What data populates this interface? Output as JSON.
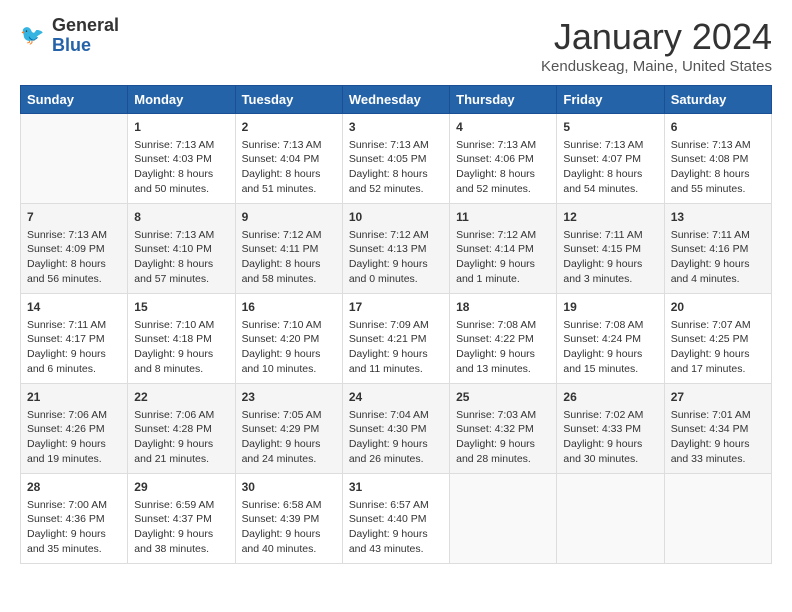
{
  "logo": {
    "line1": "General",
    "line2": "Blue"
  },
  "title": "January 2024",
  "location": "Kenduskeag, Maine, United States",
  "days_of_week": [
    "Sunday",
    "Monday",
    "Tuesday",
    "Wednesday",
    "Thursday",
    "Friday",
    "Saturday"
  ],
  "weeks": [
    [
      {
        "day": "",
        "content": ""
      },
      {
        "day": "1",
        "content": "Sunrise: 7:13 AM\nSunset: 4:03 PM\nDaylight: 8 hours\nand 50 minutes."
      },
      {
        "day": "2",
        "content": "Sunrise: 7:13 AM\nSunset: 4:04 PM\nDaylight: 8 hours\nand 51 minutes."
      },
      {
        "day": "3",
        "content": "Sunrise: 7:13 AM\nSunset: 4:05 PM\nDaylight: 8 hours\nand 52 minutes."
      },
      {
        "day": "4",
        "content": "Sunrise: 7:13 AM\nSunset: 4:06 PM\nDaylight: 8 hours\nand 52 minutes."
      },
      {
        "day": "5",
        "content": "Sunrise: 7:13 AM\nSunset: 4:07 PM\nDaylight: 8 hours\nand 54 minutes."
      },
      {
        "day": "6",
        "content": "Sunrise: 7:13 AM\nSunset: 4:08 PM\nDaylight: 8 hours\nand 55 minutes."
      }
    ],
    [
      {
        "day": "7",
        "content": "Sunrise: 7:13 AM\nSunset: 4:09 PM\nDaylight: 8 hours\nand 56 minutes."
      },
      {
        "day": "8",
        "content": "Sunrise: 7:13 AM\nSunset: 4:10 PM\nDaylight: 8 hours\nand 57 minutes."
      },
      {
        "day": "9",
        "content": "Sunrise: 7:12 AM\nSunset: 4:11 PM\nDaylight: 8 hours\nand 58 minutes."
      },
      {
        "day": "10",
        "content": "Sunrise: 7:12 AM\nSunset: 4:13 PM\nDaylight: 9 hours\nand 0 minutes."
      },
      {
        "day": "11",
        "content": "Sunrise: 7:12 AM\nSunset: 4:14 PM\nDaylight: 9 hours\nand 1 minute."
      },
      {
        "day": "12",
        "content": "Sunrise: 7:11 AM\nSunset: 4:15 PM\nDaylight: 9 hours\nand 3 minutes."
      },
      {
        "day": "13",
        "content": "Sunrise: 7:11 AM\nSunset: 4:16 PM\nDaylight: 9 hours\nand 4 minutes."
      }
    ],
    [
      {
        "day": "14",
        "content": "Sunrise: 7:11 AM\nSunset: 4:17 PM\nDaylight: 9 hours\nand 6 minutes."
      },
      {
        "day": "15",
        "content": "Sunrise: 7:10 AM\nSunset: 4:18 PM\nDaylight: 9 hours\nand 8 minutes."
      },
      {
        "day": "16",
        "content": "Sunrise: 7:10 AM\nSunset: 4:20 PM\nDaylight: 9 hours\nand 10 minutes."
      },
      {
        "day": "17",
        "content": "Sunrise: 7:09 AM\nSunset: 4:21 PM\nDaylight: 9 hours\nand 11 minutes."
      },
      {
        "day": "18",
        "content": "Sunrise: 7:08 AM\nSunset: 4:22 PM\nDaylight: 9 hours\nand 13 minutes."
      },
      {
        "day": "19",
        "content": "Sunrise: 7:08 AM\nSunset: 4:24 PM\nDaylight: 9 hours\nand 15 minutes."
      },
      {
        "day": "20",
        "content": "Sunrise: 7:07 AM\nSunset: 4:25 PM\nDaylight: 9 hours\nand 17 minutes."
      }
    ],
    [
      {
        "day": "21",
        "content": "Sunrise: 7:06 AM\nSunset: 4:26 PM\nDaylight: 9 hours\nand 19 minutes."
      },
      {
        "day": "22",
        "content": "Sunrise: 7:06 AM\nSunset: 4:28 PM\nDaylight: 9 hours\nand 21 minutes."
      },
      {
        "day": "23",
        "content": "Sunrise: 7:05 AM\nSunset: 4:29 PM\nDaylight: 9 hours\nand 24 minutes."
      },
      {
        "day": "24",
        "content": "Sunrise: 7:04 AM\nSunset: 4:30 PM\nDaylight: 9 hours\nand 26 minutes."
      },
      {
        "day": "25",
        "content": "Sunrise: 7:03 AM\nSunset: 4:32 PM\nDaylight: 9 hours\nand 28 minutes."
      },
      {
        "day": "26",
        "content": "Sunrise: 7:02 AM\nSunset: 4:33 PM\nDaylight: 9 hours\nand 30 minutes."
      },
      {
        "day": "27",
        "content": "Sunrise: 7:01 AM\nSunset: 4:34 PM\nDaylight: 9 hours\nand 33 minutes."
      }
    ],
    [
      {
        "day": "28",
        "content": "Sunrise: 7:00 AM\nSunset: 4:36 PM\nDaylight: 9 hours\nand 35 minutes."
      },
      {
        "day": "29",
        "content": "Sunrise: 6:59 AM\nSunset: 4:37 PM\nDaylight: 9 hours\nand 38 minutes."
      },
      {
        "day": "30",
        "content": "Sunrise: 6:58 AM\nSunset: 4:39 PM\nDaylight: 9 hours\nand 40 minutes."
      },
      {
        "day": "31",
        "content": "Sunrise: 6:57 AM\nSunset: 4:40 PM\nDaylight: 9 hours\nand 43 minutes."
      },
      {
        "day": "",
        "content": ""
      },
      {
        "day": "",
        "content": ""
      },
      {
        "day": "",
        "content": ""
      }
    ]
  ]
}
